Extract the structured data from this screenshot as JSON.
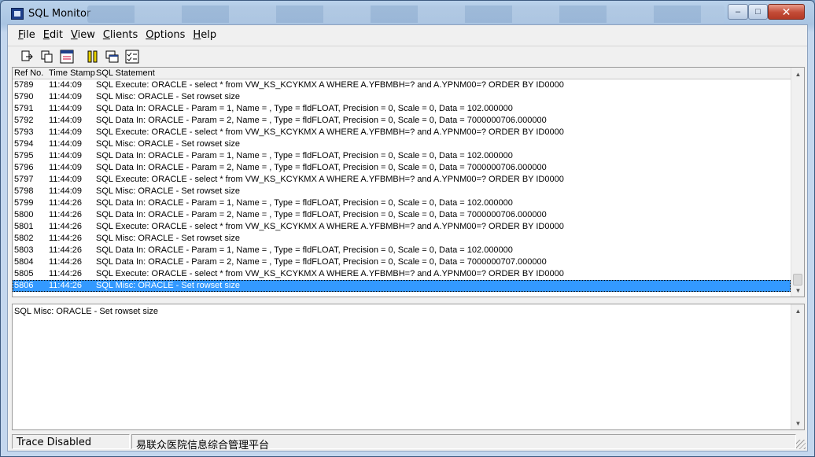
{
  "window": {
    "title": "SQL Monitor",
    "controls": {
      "minimize": "–",
      "maximize": "□",
      "close": "✕"
    }
  },
  "menu": [
    {
      "label": "File",
      "underline": "F",
      "rest": "ile"
    },
    {
      "label": "Edit",
      "underline": "E",
      "rest": "dit"
    },
    {
      "label": "View",
      "underline": "V",
      "rest": "iew"
    },
    {
      "label": "Clients",
      "underline": "C",
      "rest": "lients"
    },
    {
      "label": "Options",
      "underline": "O",
      "rest": "ptions"
    },
    {
      "label": "Help",
      "underline": "H",
      "rest": "elp"
    }
  ],
  "toolbar": [
    "save-log-icon",
    "copy-icon",
    "options-icon",
    "pause-icon",
    "windows-icon",
    "checklist-icon"
  ],
  "list": {
    "columns": [
      "Ref No.",
      "Time Stamp",
      "SQL Statement"
    ],
    "rows": [
      [
        "5789",
        "11:44:09",
        "SQL Execute: ORACLE - select * from VW_KS_KCYKMX A  WHERE A.YFBMBH=?  and A.YPNM00=?  ORDER BY ID0000"
      ],
      [
        "5790",
        "11:44:09",
        "SQL Misc: ORACLE - Set rowset size"
      ],
      [
        "5791",
        "11:44:09",
        "SQL Data In: ORACLE - Param = 1, Name = , Type = fldFLOAT, Precision = 0, Scale = 0, Data = 102.000000"
      ],
      [
        "5792",
        "11:44:09",
        "SQL Data In: ORACLE - Param = 2, Name = , Type = fldFLOAT, Precision = 0, Scale = 0, Data = 7000000706.000000"
      ],
      [
        "5793",
        "11:44:09",
        "SQL Execute: ORACLE - select * from VW_KS_KCYKMX A  WHERE A.YFBMBH=?  and A.YPNM00=?  ORDER BY ID0000"
      ],
      [
        "5794",
        "11:44:09",
        "SQL Misc: ORACLE - Set rowset size"
      ],
      [
        "5795",
        "11:44:09",
        "SQL Data In: ORACLE - Param = 1, Name = , Type = fldFLOAT, Precision = 0, Scale = 0, Data = 102.000000"
      ],
      [
        "5796",
        "11:44:09",
        "SQL Data In: ORACLE - Param = 2, Name = , Type = fldFLOAT, Precision = 0, Scale = 0, Data = 7000000706.000000"
      ],
      [
        "5797",
        "11:44:09",
        "SQL Execute: ORACLE - select * from VW_KS_KCYKMX A  WHERE A.YFBMBH=?  and A.YPNM00=?  ORDER BY ID0000"
      ],
      [
        "5798",
        "11:44:09",
        "SQL Misc: ORACLE - Set rowset size"
      ],
      [
        "5799",
        "11:44:26",
        "SQL Data In: ORACLE - Param = 1, Name = , Type = fldFLOAT, Precision = 0, Scale = 0, Data = 102.000000"
      ],
      [
        "5800",
        "11:44:26",
        "SQL Data In: ORACLE - Param = 2, Name = , Type = fldFLOAT, Precision = 0, Scale = 0, Data = 7000000706.000000"
      ],
      [
        "5801",
        "11:44:26",
        "SQL Execute: ORACLE - select * from VW_KS_KCYKMX A  WHERE A.YFBMBH=?  and A.YPNM00=?  ORDER BY ID0000"
      ],
      [
        "5802",
        "11:44:26",
        "SQL Misc: ORACLE - Set rowset size"
      ],
      [
        "5803",
        "11:44:26",
        "SQL Data In: ORACLE - Param = 1, Name = , Type = fldFLOAT, Precision = 0, Scale = 0, Data = 102.000000"
      ],
      [
        "5804",
        "11:44:26",
        "SQL Data In: ORACLE - Param = 2, Name = , Type = fldFLOAT, Precision = 0, Scale = 0, Data = 7000000707.000000"
      ],
      [
        "5805",
        "11:44:26",
        "SQL Execute: ORACLE - select * from VW_KS_KCYKMX A  WHERE A.YFBMBH=?  and A.YPNM00=?  ORDER BY ID0000"
      ],
      [
        "5806",
        "11:44:26",
        "SQL Misc: ORACLE - Set rowset size"
      ]
    ],
    "selected_index": 17
  },
  "detail": {
    "text": "SQL Misc: ORACLE - Set rowset size"
  },
  "status": {
    "trace": "Trace Disabled",
    "app": "易联众医院信息综合管理平台"
  },
  "colors": {
    "selection": "#3399ff",
    "close_button": "#c24b36"
  }
}
